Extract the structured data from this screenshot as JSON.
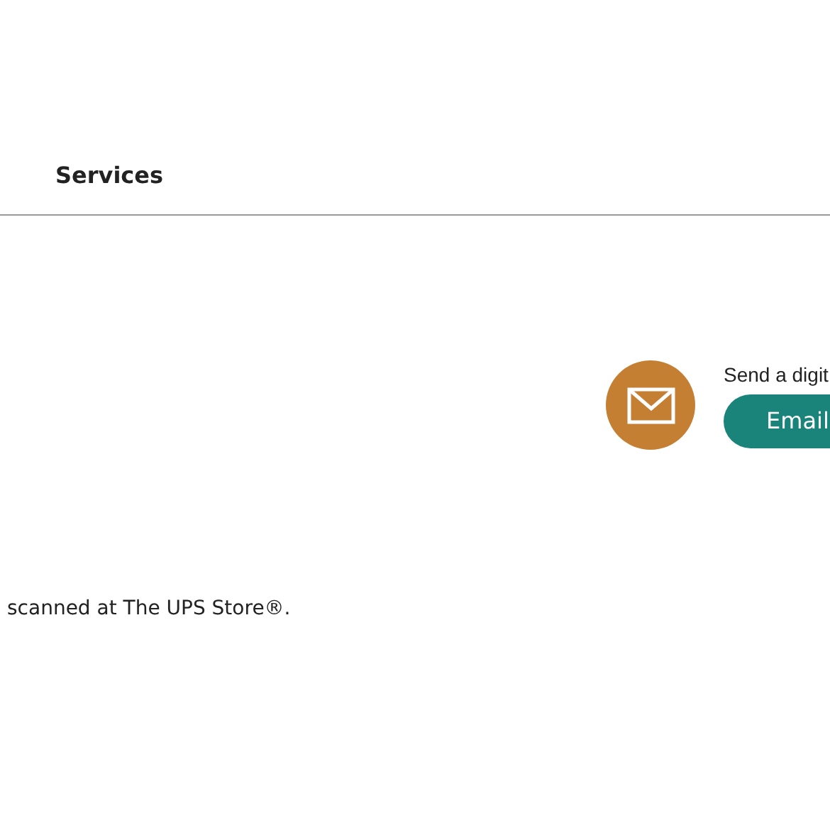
{
  "header": {
    "title": "Services"
  },
  "email_option": {
    "description": "Send a digit",
    "button": "Email"
  },
  "footer_text": "scanned at The UPS Store®."
}
